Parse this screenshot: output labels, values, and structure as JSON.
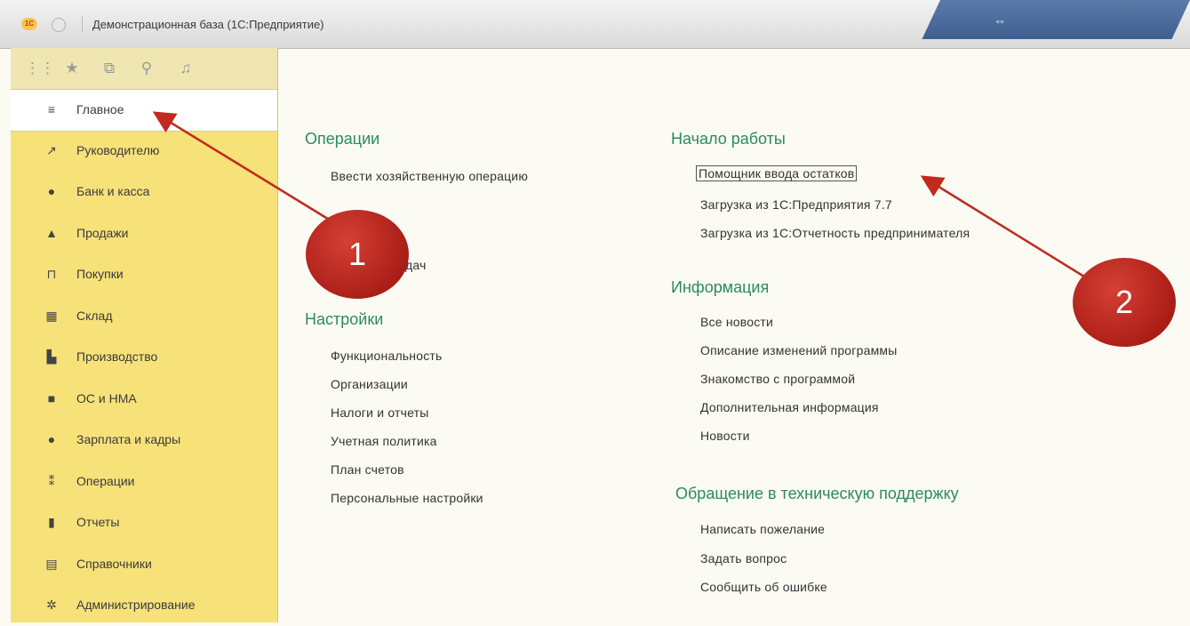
{
  "window": {
    "logo": "1C",
    "title": "Демонстрационная база  (1С:Предприятие)"
  },
  "sidebar": {
    "toolbar": [
      {
        "name": "apps-grid-icon",
        "glyph": "⋮⋮⋮"
      },
      {
        "name": "star-icon",
        "glyph": "★"
      },
      {
        "name": "history-icon",
        "glyph": "⧉"
      },
      {
        "name": "search-icon",
        "glyph": "⚲"
      },
      {
        "name": "bell-icon",
        "glyph": "🔔"
      }
    ],
    "items": [
      {
        "label": "Главное",
        "icon": "≡",
        "icon_name": "menu-lines-icon",
        "active": true
      },
      {
        "label": "Руководителю",
        "icon": "↗",
        "icon_name": "trend-icon"
      },
      {
        "label": "Банк и касса",
        "icon": "●",
        "icon_name": "money-icon"
      },
      {
        "label": "Продажи",
        "icon": "▲",
        "icon_name": "bag-icon"
      },
      {
        "label": "Покупки",
        "icon": "⊓",
        "icon_name": "cart-icon"
      },
      {
        "label": "Склад",
        "icon": "▦",
        "icon_name": "warehouse-icon"
      },
      {
        "label": "Производство",
        "icon": "▙",
        "icon_name": "factory-icon"
      },
      {
        "label": "ОС и НМА",
        "icon": "■",
        "icon_name": "truck-icon"
      },
      {
        "label": "Зарплата и кадры",
        "icon": "●",
        "icon_name": "person-icon"
      },
      {
        "label": "Операции",
        "icon": "⁑",
        "icon_name": "operations-icon"
      },
      {
        "label": "Отчеты",
        "icon": "▮",
        "icon_name": "bar-chart-icon"
      },
      {
        "label": "Справочники",
        "icon": "▤",
        "icon_name": "book-icon"
      },
      {
        "label": "Администрирование",
        "icon": "✲",
        "icon_name": "gear-icon"
      }
    ]
  },
  "main": {
    "col1": {
      "operations": {
        "heading": "Операции",
        "items": [
          "Ввести хозяйственную операцию",
          "дач"
        ]
      },
      "settings": {
        "heading": "Настройки",
        "items": [
          "Функциональность",
          "Организации",
          "Налоги и отчеты",
          "Учетная политика",
          "План счетов",
          "Персональные настройки"
        ]
      }
    },
    "col2": {
      "start": {
        "heading": "Начало работы",
        "items": [
          "Помощник ввода остатков",
          "Загрузка из 1С:Предприятия 7.7",
          "Загрузка из 1С:Отчетность предпринимателя"
        ]
      },
      "info": {
        "heading": "Информация",
        "items": [
          "Все новости",
          "Описание изменений программы",
          "Знакомство с программой",
          "Дополнительная информация",
          "Новости"
        ]
      },
      "support": {
        "heading": "Обращение в техническую поддержку",
        "items": [
          "Написать пожелание",
          "Задать вопрос",
          "Сообщить об ошибке"
        ]
      }
    }
  },
  "annotations": {
    "callout1": "1",
    "callout2": "2",
    "color": "#c02a1f"
  }
}
